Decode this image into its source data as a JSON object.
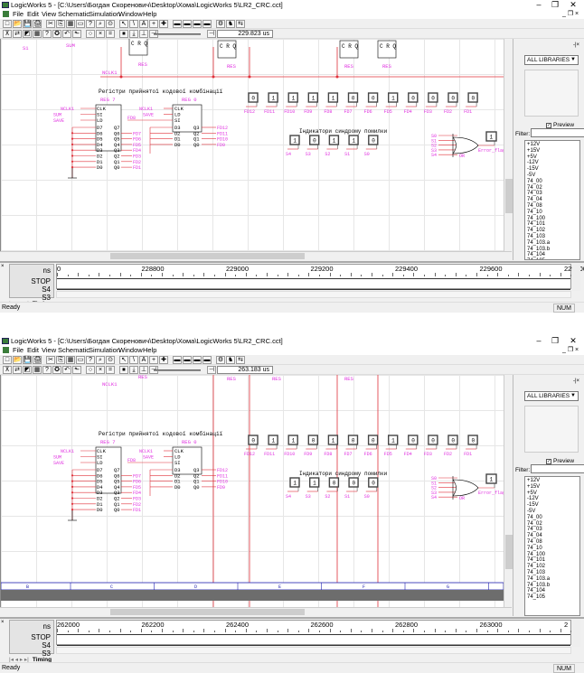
{
  "windows": [
    {
      "title": "LogicWorks 5 - [C:\\Users\\Богдан Скоренович\\Desktop\\Хома\\LogicWorks 5\\LR2_CRC.cct]",
      "menu": [
        "File",
        "Edit",
        "View",
        "Schematic",
        "Simulation",
        "Window",
        "Help"
      ],
      "time": "229.823 us",
      "register_caption": "Регістри прийнятої кодової комбінації",
      "reg7_name": "REG 7",
      "reg0_name": "REG 0",
      "probe_values": [
        "0",
        "1",
        "1",
        "1",
        "1",
        "0",
        "0",
        "1",
        "0",
        "0",
        "0",
        "0"
      ],
      "syndrome_caption": "Індикатори синдрому помилки",
      "syndrome_values": [
        "1",
        "0",
        "1",
        "1",
        "0"
      ],
      "error_flag_value": "1",
      "ruler_ticks": [
        "0",
        "228800",
        "229000",
        "229200",
        "229400",
        "229600",
        "229800"
      ],
      "top_labels": [
        "S1",
        "SUM",
        "RES",
        "RES",
        "RES",
        "RES",
        "NCLK1"
      ],
      "show_border": false,
      "border_labels": []
    },
    {
      "title": "LogicWorks 5 - [C:\\Users\\Богдан Скоренович\\Desktop\\Хома\\LogicWorks 5\\LR2_CRC.cct]",
      "menu": [
        "File",
        "Edit",
        "View",
        "Schematic",
        "Simulation",
        "Window",
        "Help"
      ],
      "time": "263.183 us",
      "register_caption": "Регістри прийнятої кодової комбінації",
      "reg7_name": "REG 7",
      "reg0_name": "REG 0",
      "probe_values": [
        "0",
        "1",
        "1",
        "0",
        "1",
        "0",
        "0",
        "1",
        "0",
        "0",
        "0",
        "0"
      ],
      "syndrome_caption": "Індикатори синдрому помилки",
      "syndrome_values": [
        "1",
        "1",
        "0",
        "0",
        "0"
      ],
      "error_flag_value": "1",
      "ruler_ticks": [
        "262000",
        "262200",
        "262400",
        "262600",
        "262800",
        "263000",
        "2"
      ],
      "top_labels": [
        "RES",
        "RES",
        "RES",
        "RES",
        "NCLK1"
      ],
      "show_border": true,
      "border_labels": [
        "B",
        "C",
        "D",
        "E",
        "F",
        "G"
      ]
    }
  ],
  "probe_labels": [
    "FD12",
    "FD11",
    "FD10",
    "FD9",
    "FD8",
    "FD7",
    "FD6",
    "FD5",
    "FD4",
    "FD3",
    "FD2",
    "FD1"
  ],
  "syndrome_labels": [
    "S4",
    "S3",
    "S2",
    "S1",
    "S0"
  ],
  "or_inputs": [
    "S0",
    "S1",
    "S2",
    "S3",
    "S4"
  ],
  "or_name": "OR",
  "error_flag_label": "Error_flag",
  "reg7_inputs": [
    "D7",
    "D6",
    "D5",
    "D4",
    "D3",
    "D2",
    "D1",
    "D0"
  ],
  "reg7_outputs": [
    "Q7",
    "Q6",
    "Q5",
    "Q4",
    "Q3",
    "Q2",
    "Q1",
    "Q0"
  ],
  "reg7_out_nets": [
    "FD7",
    "FD6",
    "FD5",
    "FD4",
    "FD3",
    "FD2",
    "FD1"
  ],
  "reg7_ctrl": [
    "CLK",
    "SI",
    "LD"
  ],
  "reg7_ctrl_nets": [
    "NCLK1",
    "SUM",
    "SAVE"
  ],
  "reg0_inputs": [
    "D3",
    "D2",
    "D1",
    "D0"
  ],
  "reg0_outputs": [
    "Q3",
    "Q2",
    "Q1",
    "Q0"
  ],
  "reg0_out_nets": [
    "FD12",
    "FD11",
    "FD10",
    "FD9"
  ],
  "reg0_ctrl": [
    "CLK",
    "LD",
    "SI"
  ],
  "reg0_ctrl_nets": [
    "NCLK1",
    "SAVE",
    "FD8"
  ],
  "toolbar1": [
    "□",
    "📂",
    "💾",
    "🖨",
    "✂",
    "⎘",
    "▦",
    "▭",
    "?",
    "⌕",
    "⊙",
    "↖",
    "\\",
    "A",
    "+",
    "✚",
    "▬",
    "▬",
    "▬",
    "▬",
    "⚙",
    "♞",
    "⇆"
  ],
  "toolbar2": [
    "⊼",
    "⇄",
    "◩",
    "▦",
    "?",
    "✪",
    "↶",
    "⬑",
    "○",
    "×",
    "=",
    "⏹",
    "⤓",
    "⊥",
    "⊣"
  ],
  "library": {
    "dropdown": "ALL LIBRARIES",
    "preview_label": "Preview",
    "filter_label": "Filter:",
    "items": [
      "+12V",
      "+15V",
      "+5V",
      "-12V",
      "-15V",
      "-5V",
      "74_00",
      "74_02",
      "74_03",
      "74_04",
      "74_08",
      "74_10",
      "74_100",
      "74_101",
      "74_102",
      "74_103",
      "74_103.a",
      "74_103.b",
      "74_104",
      "74_105"
    ]
  },
  "timing": {
    "unit": "ns",
    "signals": [
      "STOP",
      "S4",
      "S3"
    ],
    "tab": "Timing"
  },
  "status": {
    "ready": "Ready",
    "num": "NUM"
  },
  "colors": {
    "wire": "#e0303a",
    "net": "#e030e0",
    "border": "#2020b0"
  }
}
